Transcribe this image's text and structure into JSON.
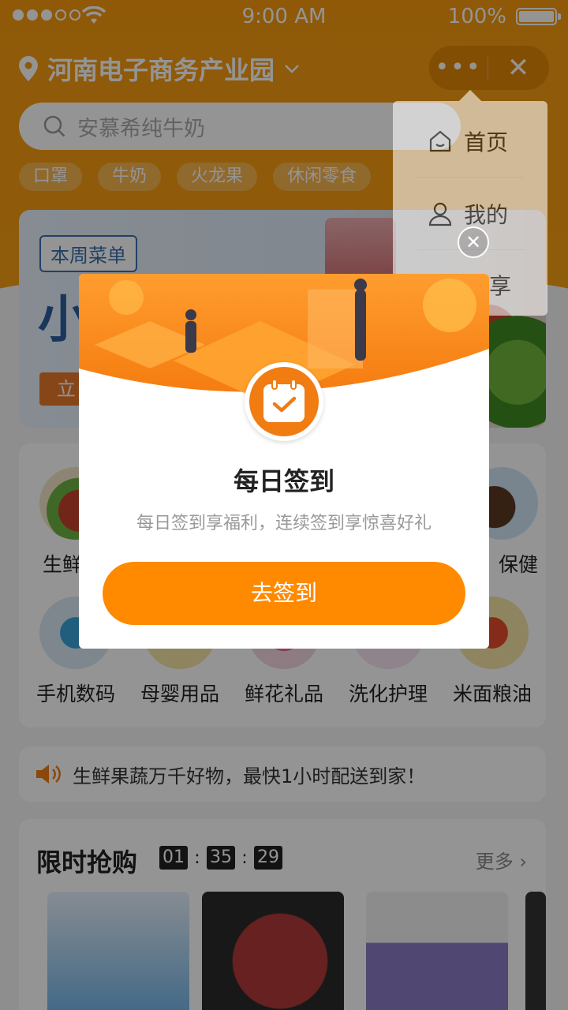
{
  "status_bar": {
    "time": "9:00 AM",
    "battery": "100%"
  },
  "header": {
    "location": "河南电子商务产业园",
    "more_glyph": "•••",
    "close_glyph": "✕"
  },
  "search": {
    "placeholder": "安慕希纯牛奶"
  },
  "chips": [
    "口罩",
    "牛奶",
    "火龙果",
    "休闲零食"
  ],
  "banner": {
    "tag": "本周菜单",
    "headline": "小",
    "button": "立"
  },
  "categories": {
    "row1": [
      {
        "label": "生鲜"
      },
      {
        "label": "保健"
      }
    ],
    "row2": [
      {
        "label": "手机数码"
      },
      {
        "label": "母婴用品"
      },
      {
        "label": "鲜花礼品"
      },
      {
        "label": "洗化护理"
      },
      {
        "label": "米面粮油"
      }
    ]
  },
  "notice": {
    "text": "生鲜果蔬万千好物，最快1小时配送到家！"
  },
  "flash_sale": {
    "title": "限时抢购",
    "timer": [
      "01",
      "35",
      "29"
    ],
    "more": "更多"
  },
  "menu": {
    "items": [
      {
        "label": "首页"
      },
      {
        "label": "我的"
      },
      {
        "label": "享"
      }
    ]
  },
  "modal": {
    "close_glyph": "✕",
    "title": "每日签到",
    "subtitle": "每日签到享福利，连续签到享惊喜好礼",
    "button": "去签到"
  },
  "colors": {
    "brand_orange": "#f79a0f",
    "button_orange": "#ff8a00",
    "badge_orange": "#f07c12"
  }
}
